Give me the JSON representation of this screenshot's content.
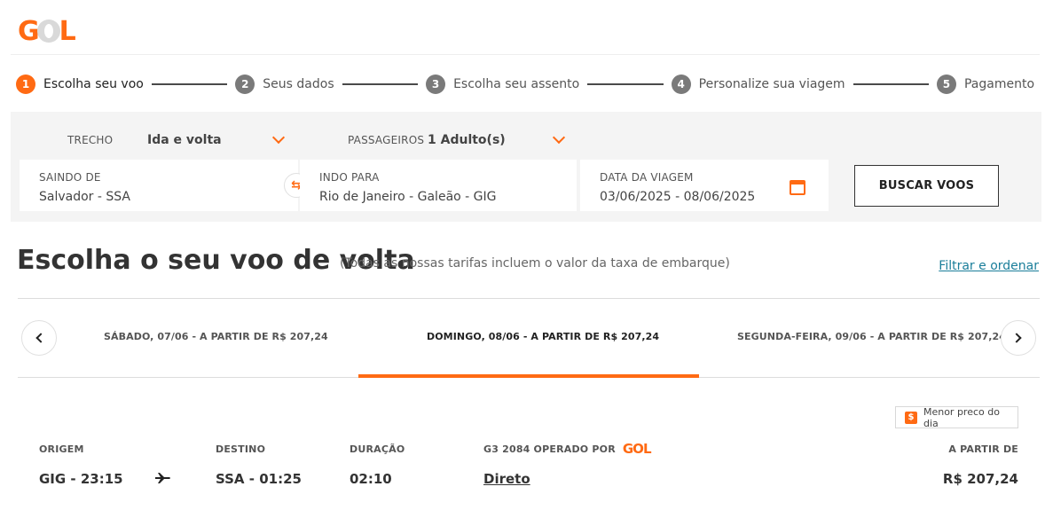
{
  "brand": {
    "logo_text": "GOL",
    "accent_color": "#ff6a13"
  },
  "steps": [
    {
      "number": "1",
      "label": "Escolha seu voo",
      "active": true
    },
    {
      "number": "2",
      "label": "Seus dados",
      "active": false
    },
    {
      "number": "3",
      "label": "Escolha seu assento",
      "active": false
    },
    {
      "number": "4",
      "label": "Personalize sua viagem",
      "active": false
    },
    {
      "number": "5",
      "label": "Pagamento",
      "active": false
    }
  ],
  "search": {
    "trecho_label": "TRECHO",
    "trecho_value": "Ida e volta",
    "passageiros_label": "PASSAGEIROS",
    "passageiros_value": "1 Adulto(s)",
    "origin_label": "SAINDO DE",
    "origin_value": "Salvador - SSA",
    "destination_label": "INDO PARA",
    "destination_value": "Rio de Janeiro  -  Galeão - GIG",
    "date_label": "DATA DA VIAGEM",
    "date_value": "03/06/2025 -  08/06/2025",
    "search_button": "BUSCAR VOOS"
  },
  "results": {
    "title": "Escolha o seu voo de volta",
    "subtitle": "(Todas as nossas tarifas incluem o valor da taxa de embarque)",
    "filter_link": "Filtrar e ordenar"
  },
  "date_tabs": [
    {
      "label": "SÁBADO, 07/06 - A PARTIR DE R$ 207,24",
      "active": false
    },
    {
      "label": "DOMINGO, 08/06 - A PARTIR DE R$ 207,24",
      "active": true
    },
    {
      "label": "SEGUNDA-FEIRA, 09/06 - A PARTIR DE R$ 207,24",
      "active": false
    }
  ],
  "flight": {
    "best_price_badge": "Menor preco do dia",
    "origin_label": "ORIGEM",
    "origin_value": "GIG - 23:15",
    "destination_label": "DESTINO",
    "destination_value": "SSA - 01:25",
    "duration_label": "DURAÇÃO",
    "duration_value": "02:10",
    "operator_label": "G3 2084 OPERADO POR",
    "operator_logo": "GOL",
    "stops_value": "Direto",
    "price_label": "A PARTIR DE",
    "price_value": "R$ 207,24"
  }
}
